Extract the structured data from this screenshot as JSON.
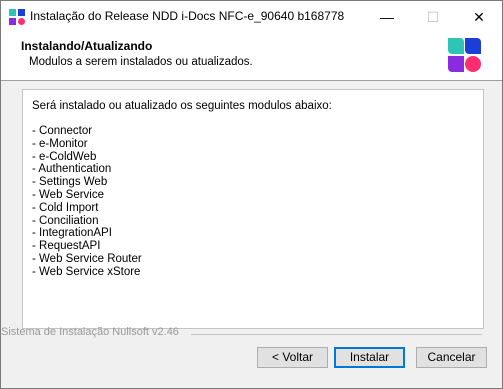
{
  "window": {
    "title": "Instalação do Release NDD i-Docs NFC-e_90640 b168778",
    "controls": {
      "minimize": "—",
      "maximize": "☐",
      "close": "✕"
    }
  },
  "header": {
    "title": "Instalando/Atualizando",
    "subtitle": "Modulos a serem instalados ou atualizados."
  },
  "content": {
    "intro": "Será instalado ou atualizado os seguintes modulos abaixo:",
    "modules": [
      "- Connector",
      "- e-Monitor",
      "- e-ColdWeb",
      "- Authentication",
      "- Settings Web",
      "- Web Service",
      "- Cold Import",
      "- Conciliation",
      "- IntegrationAPI",
      "- RequestAPI",
      "- Web Service Router",
      "- Web Service xStore"
    ]
  },
  "footer": {
    "branding": "Sistema de Instalação Nullsoft v2.46",
    "back_label": "< Voltar",
    "install_label": "Instalar",
    "cancel_label": "Cancelar"
  },
  "colors": {
    "logo_teal": "#2ec4b6",
    "logo_blue": "#1b3fd6",
    "logo_purple": "#8a2be2",
    "logo_pink": "#ff2d6f",
    "accent_focus": "#0078d7"
  }
}
